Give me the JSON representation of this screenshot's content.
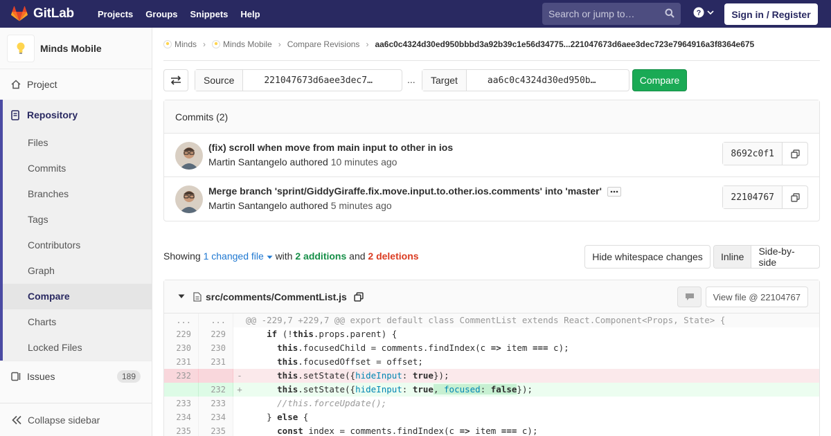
{
  "navbar": {
    "brand": "GitLab",
    "links": [
      "Projects",
      "Groups",
      "Snippets",
      "Help"
    ],
    "search_placeholder": "Search or jump to…",
    "signin": "Sign in / Register"
  },
  "sidebar": {
    "project_name": "Minds Mobile",
    "project": "Project",
    "repository": "Repository",
    "repo_items": [
      "Files",
      "Commits",
      "Branches",
      "Tags",
      "Contributors",
      "Graph",
      "Compare",
      "Charts",
      "Locked Files"
    ],
    "active_item": "Compare",
    "issues": "Issues",
    "issues_count": "189",
    "collapse": "Collapse sidebar"
  },
  "breadcrumb": {
    "items": [
      "Minds",
      "Minds Mobile",
      "Compare Revisions"
    ],
    "current": "aa6c0c4324d30ed950bbbd3a92b39c1e56d34775...221047673d6aee3dec723e7964916a3f8364e675"
  },
  "compare": {
    "source_label": "Source",
    "source_value": "221047673d6aee3dec7…",
    "dots": "...",
    "target_label": "Target",
    "target_value": "aa6c0c4324d30ed950b…",
    "button": "Compare"
  },
  "commits": {
    "header": "Commits (2)",
    "list": [
      {
        "title": "(fix) scroll when move from main input to other in ios",
        "author": "Martin Santangelo",
        "verb": "authored",
        "time": "10 minutes ago",
        "sha": "8692c0f1"
      },
      {
        "title": "Merge branch 'sprint/GiddyGiraffe.fix.move.input.to.other.ios.comments' into 'master'",
        "author": "Martin Santangelo",
        "verb": "authored",
        "time": "5 minutes ago",
        "sha": "22104767"
      }
    ]
  },
  "summary": {
    "showing": "Showing",
    "changed": "1 changed file",
    "with": "with",
    "additions": "2 additions",
    "and": "and",
    "deletions": "2 deletions",
    "hide_ws": "Hide whitespace changes",
    "inline": "Inline",
    "side_by_side": "Side-by-side"
  },
  "file": {
    "path": "src/comments/CommentList.js",
    "view_file": "View file @ 22104767"
  },
  "diff": {
    "hunk": "@@ -229,7 +229,7 @@ export default class CommentList extends React.Component<Props, State> {",
    "lines": [
      {
        "old": "229",
        "new": "229"
      },
      {
        "old": "230",
        "new": "230"
      },
      {
        "old": "231",
        "new": "231"
      },
      {
        "old": "232",
        "new": ""
      },
      {
        "old": "",
        "new": "232"
      },
      {
        "old": "233",
        "new": "233"
      },
      {
        "old": "234",
        "new": "234"
      },
      {
        "old": "235",
        "new": "235"
      }
    ]
  }
}
